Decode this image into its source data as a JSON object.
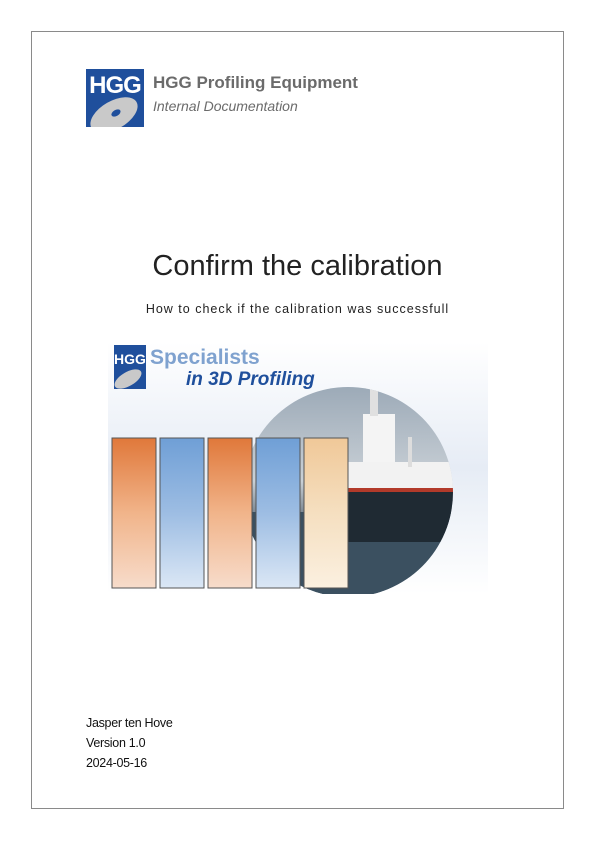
{
  "header": {
    "logo_text": "HGG",
    "company_name": "HGG Profiling Equipment",
    "company_subtitle": "Internal Documentation"
  },
  "document": {
    "title": "Confirm the calibration",
    "subtitle": "How to check if the calibration was successfull"
  },
  "cover_image": {
    "logo_text": "HGG",
    "tagline_line1": "Specialists",
    "tagline_line2": "in 3D Profiling",
    "colors": {
      "brand_blue": "#1f4f9c",
      "orange": "#e0783a",
      "light_blue": "#6f9fd6",
      "cream": "#f0d9b0"
    }
  },
  "footer": {
    "author": "Jasper ten Hove",
    "version": "Version 1.0",
    "date": "2024-05-16"
  }
}
